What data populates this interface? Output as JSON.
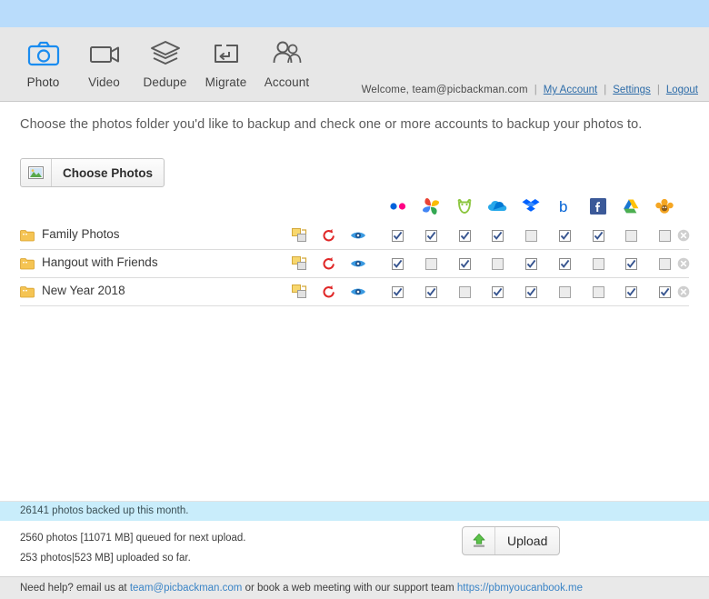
{
  "header": {
    "nav": [
      {
        "label": "Photo",
        "icon": "camera-icon",
        "active": true
      },
      {
        "label": "Video",
        "icon": "video-icon",
        "active": false
      },
      {
        "label": "Dedupe",
        "icon": "layers-icon",
        "active": false
      },
      {
        "label": "Migrate",
        "icon": "migrate-icon",
        "active": false
      },
      {
        "label": "Account",
        "icon": "users-icon",
        "active": false
      }
    ],
    "account": {
      "welcome": "Welcome,  team@picbackman.com",
      "my_account": "My Account",
      "settings": "Settings",
      "logout": "Logout",
      "separator": "|"
    }
  },
  "main": {
    "instruction": "Choose the photos folder you'd like to backup and check one or more accounts to backup your photos to.",
    "choose_button": {
      "label": "Choose Photos",
      "icon": "picture-icon"
    },
    "services": [
      {
        "name": "Flickr",
        "icon": "flickr-icon"
      },
      {
        "name": "Google Photos",
        "icon": "google-photos-icon"
      },
      {
        "name": "SmugMug",
        "icon": "smugmug-icon"
      },
      {
        "name": "OneDrive",
        "icon": "onedrive-icon"
      },
      {
        "name": "Dropbox",
        "icon": "dropbox-icon"
      },
      {
        "name": "Box",
        "icon": "box-icon"
      },
      {
        "name": "Facebook",
        "icon": "facebook-icon"
      },
      {
        "name": "Google Drive",
        "icon": "google-drive-icon"
      },
      {
        "name": "Monkey",
        "icon": "monkey-icon"
      }
    ],
    "row_actions": [
      {
        "name": "duplicate",
        "icon": "copy-icon"
      },
      {
        "name": "reset",
        "icon": "reset-icon"
      },
      {
        "name": "preview",
        "icon": "eye-icon"
      }
    ],
    "folders": [
      {
        "name": "Family Photos",
        "checks": [
          true,
          true,
          true,
          true,
          false,
          true,
          true,
          false,
          false
        ]
      },
      {
        "name": "Hangout with Friends",
        "checks": [
          true,
          false,
          true,
          false,
          true,
          true,
          false,
          true,
          false
        ]
      },
      {
        "name": "New Year 2018",
        "checks": [
          true,
          true,
          false,
          true,
          true,
          false,
          false,
          true,
          true
        ]
      }
    ]
  },
  "footer": {
    "status": "26141 photos backed up this month.",
    "queued": "2560 photos [11071 MB] queued for next upload.",
    "uploaded": "253 photos|523 MB] uploaded so far.",
    "upload_button": {
      "label": "Upload",
      "icon": "upload-arrow-icon"
    },
    "help": {
      "prefix": "Need help? email us at",
      "email": "team@picbackman.com",
      "middle": "or book a web meeting with our support team",
      "link": "https://pbmyoucanbook.me"
    }
  },
  "colors": {
    "banner": "#b9dcfb",
    "toolbar": "#e7e7e7",
    "accent_blue": "#2d6ca8",
    "status_bar": "#c9edfb",
    "check_blue": "#36548f"
  }
}
